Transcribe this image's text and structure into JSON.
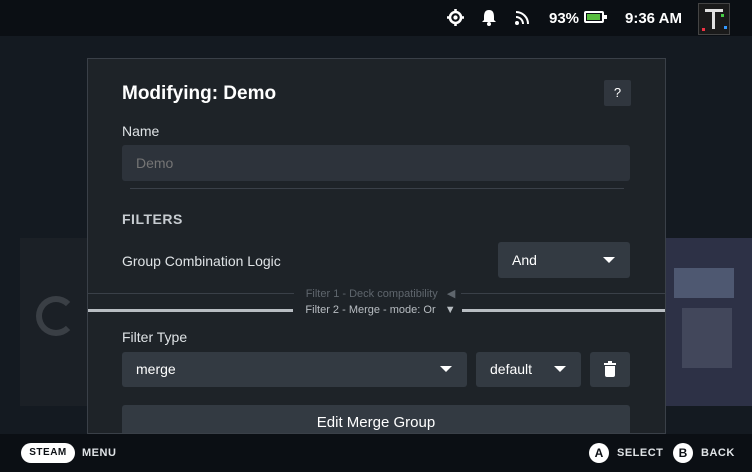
{
  "status_bar": {
    "battery_percent": "93%",
    "time": "9:36 AM",
    "icons": [
      "gear-icon",
      "bell-icon",
      "wifi-icon",
      "battery-icon"
    ]
  },
  "modal": {
    "title": "Modifying: Demo",
    "help_label": "?",
    "name_label": "Name",
    "name_placeholder": "Demo",
    "filters_heading": "FILTERS",
    "group_logic_label": "Group Combination Logic",
    "group_logic_value": "And",
    "filter_tabs": [
      {
        "label": "Filter 1 - Deck compatibility",
        "arrow": "◀"
      },
      {
        "label": "Filter 2 - Merge - mode: Or",
        "arrow": "▼"
      }
    ],
    "filter_type_label": "Filter Type",
    "filter_type_value": "merge",
    "filter_mode_value": "default",
    "edit_button_label": "Edit Merge Group"
  },
  "footer": {
    "steam_label": "STEAM",
    "menu_label": "MENU",
    "a_key": "A",
    "select_label": "SELECT",
    "b_key": "B",
    "back_label": "BACK"
  }
}
